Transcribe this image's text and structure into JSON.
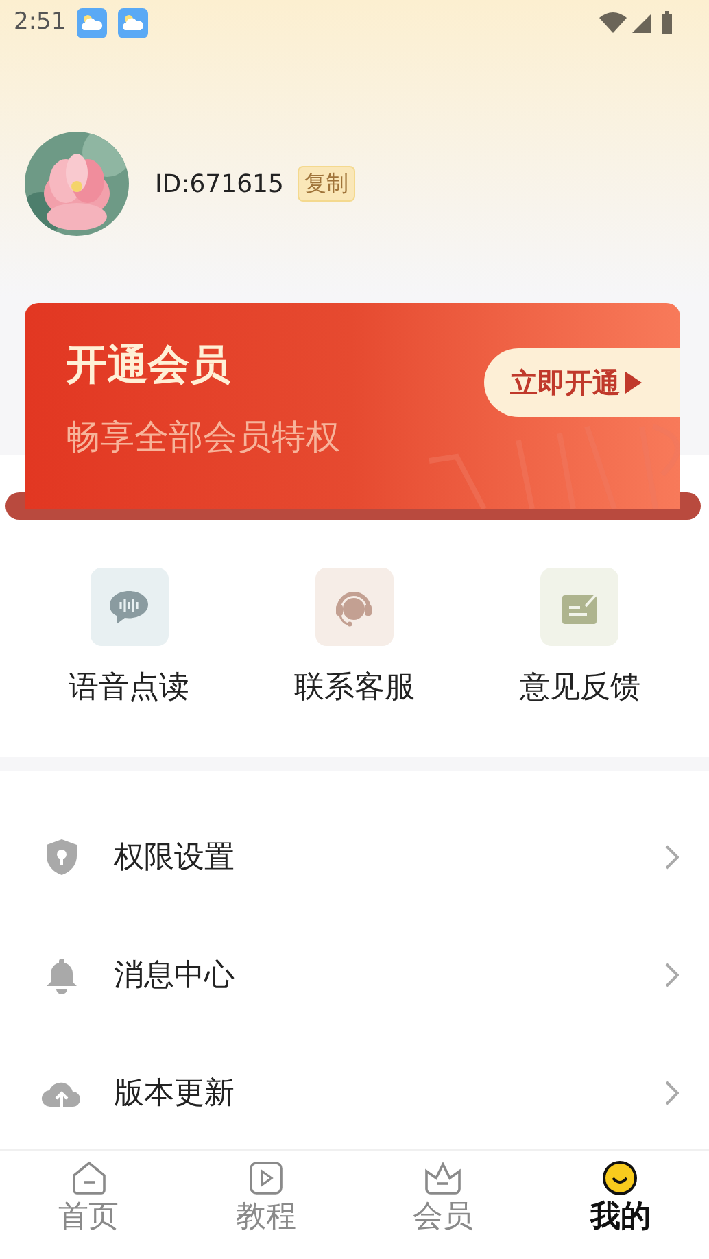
{
  "status_bar": {
    "time": "2:51"
  },
  "profile": {
    "id_text": "ID:671615",
    "copy_label": "复制"
  },
  "vip_banner": {
    "title": "开通会员",
    "subtitle": "畅享全部会员特权",
    "button": "立即开通"
  },
  "quick_actions": [
    {
      "kind": "voice",
      "label": "语音点读"
    },
    {
      "kind": "support",
      "label": "联系客服"
    },
    {
      "kind": "feedback",
      "label": "意见反馈"
    }
  ],
  "menu": [
    {
      "kind": "permission",
      "label": "权限设置"
    },
    {
      "kind": "message",
      "label": "消息中心"
    },
    {
      "kind": "update",
      "label": "版本更新"
    }
  ],
  "bottom_nav": [
    {
      "kind": "home",
      "label": "首页",
      "selected": false
    },
    {
      "kind": "tutorial",
      "label": "教程",
      "selected": false
    },
    {
      "kind": "member",
      "label": "会员",
      "selected": false
    },
    {
      "kind": "mine",
      "label": "我的",
      "selected": true
    }
  ]
}
